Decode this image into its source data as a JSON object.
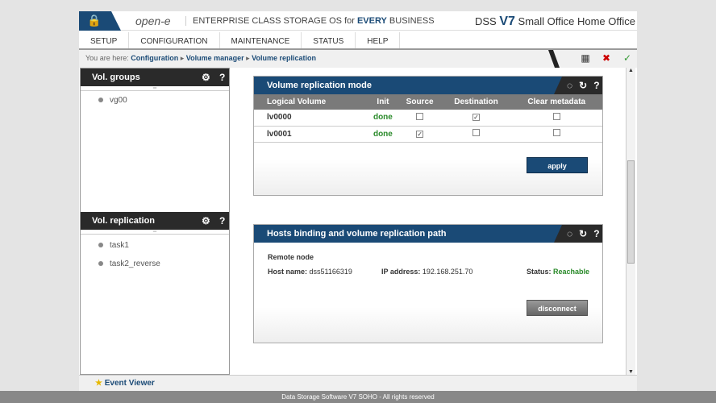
{
  "header": {
    "logo": "open-e",
    "tagline_a": "ENTERPRISE CLASS STORAGE OS for ",
    "tagline_b": "EVERY",
    "tagline_c": " BUSINESS",
    "product_a": "DSS ",
    "product_b": "V7",
    "product_c": " Small Office Home Office"
  },
  "menu": [
    "SETUP",
    "CONFIGURATION",
    "MAINTENANCE",
    "STATUS",
    "HELP"
  ],
  "breadcrumb": {
    "prefix": "You are here:",
    "items": [
      "Configuration",
      "Volume manager",
      "Volume replication"
    ]
  },
  "left": {
    "groups_title": "Vol. groups",
    "groups": [
      "vg00"
    ],
    "replication_title": "Vol. replication",
    "tasks": [
      "task1",
      "task2_reverse"
    ]
  },
  "mode_panel": {
    "title": "Volume replication mode",
    "columns": [
      "Logical Volume",
      "Init",
      "Source",
      "Destination",
      "Clear metadata"
    ],
    "rows": [
      {
        "name": "lv0000",
        "init": "done",
        "source": false,
        "destination": true,
        "clear": false
      },
      {
        "name": "lv0001",
        "init": "done",
        "source": true,
        "destination": false,
        "clear": false
      }
    ],
    "apply": "apply"
  },
  "hosts_panel": {
    "title": "Hosts binding and volume replication path",
    "remote_label": "Remote node",
    "host_label": "Host name:",
    "host": "dss51166319",
    "ip_label": "IP address:",
    "ip": "192.168.251.70",
    "status_label": "Status:",
    "status": "Reachable",
    "disconnect": "disconnect"
  },
  "event_viewer": "Event Viewer",
  "footer": "Data Storage Software V7 SOHO - All rights reserved"
}
